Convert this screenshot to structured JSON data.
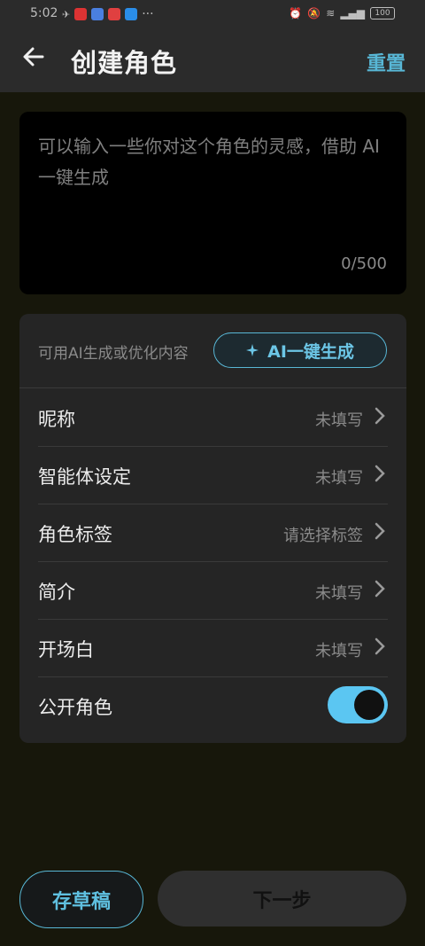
{
  "status_bar": {
    "time": "5:02",
    "battery": "100"
  },
  "header": {
    "title": "创建角色",
    "reset_label": "重置"
  },
  "inspiration": {
    "placeholder": "可以输入一些你对这个角色的灵感，借助 AI 一键生成",
    "counter": "0/500"
  },
  "ai": {
    "hint": "可用AI生成或优化内容",
    "button_label": "AI一键生成"
  },
  "fields": [
    {
      "label": "昵称",
      "value": "未填写"
    },
    {
      "label": "智能体设定",
      "value": "未填写"
    },
    {
      "label": "角色标签",
      "value": "请选择标签"
    },
    {
      "label": "简介",
      "value": "未填写"
    },
    {
      "label": "开场白",
      "value": "未填写"
    }
  ],
  "public_toggle": {
    "label": "公开角色",
    "on": true
  },
  "footer": {
    "draft_label": "存草稿",
    "next_label": "下一步"
  },
  "colors": {
    "accent": "#58b7d6",
    "toggle_on": "#5bc6f2"
  }
}
